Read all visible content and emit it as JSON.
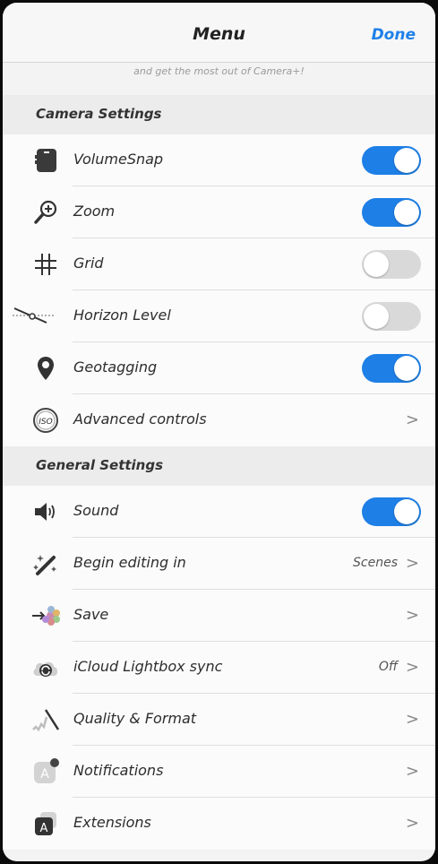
{
  "header": {
    "title": "Menu",
    "done_label": "Done"
  },
  "subtext": "and get the most out of Camera+!",
  "sections": {
    "camera": "Camera Settings",
    "general": "General Settings"
  },
  "camera_rows": [
    {
      "label": "VolumeSnap",
      "icon": "volume-snap-icon",
      "toggle": true
    },
    {
      "label": "Zoom",
      "icon": "zoom-icon",
      "toggle": true
    },
    {
      "label": "Grid",
      "icon": "grid-icon",
      "toggle": false
    },
    {
      "label": "Horizon Level",
      "icon": "horizon-level-icon",
      "toggle": false
    },
    {
      "label": "Geotagging",
      "icon": "location-pin-icon",
      "toggle": true
    },
    {
      "label": "Advanced controls",
      "icon": "iso-icon",
      "chevron": ">"
    }
  ],
  "general_rows": [
    {
      "label": "Sound",
      "icon": "speaker-icon",
      "toggle": true
    },
    {
      "label": "Begin editing in",
      "icon": "magic-wand-icon",
      "value": "Scenes",
      "chevron": ">"
    },
    {
      "label": "Save",
      "icon": "save-icon",
      "chevron": ">"
    },
    {
      "label": "iCloud Lightbox sync",
      "icon": "icloud-sync-icon",
      "value": "Off",
      "chevron": ">"
    },
    {
      "label": "Quality & Format",
      "icon": "quality-icon",
      "chevron": ">"
    },
    {
      "label": "Notifications",
      "icon": "notifications-icon",
      "chevron": ">"
    },
    {
      "label": "Extensions",
      "icon": "extensions-icon",
      "chevron": ">"
    }
  ],
  "colors": {
    "accent": "#1e7fe6",
    "toggle_off": "#d9d9d9"
  }
}
